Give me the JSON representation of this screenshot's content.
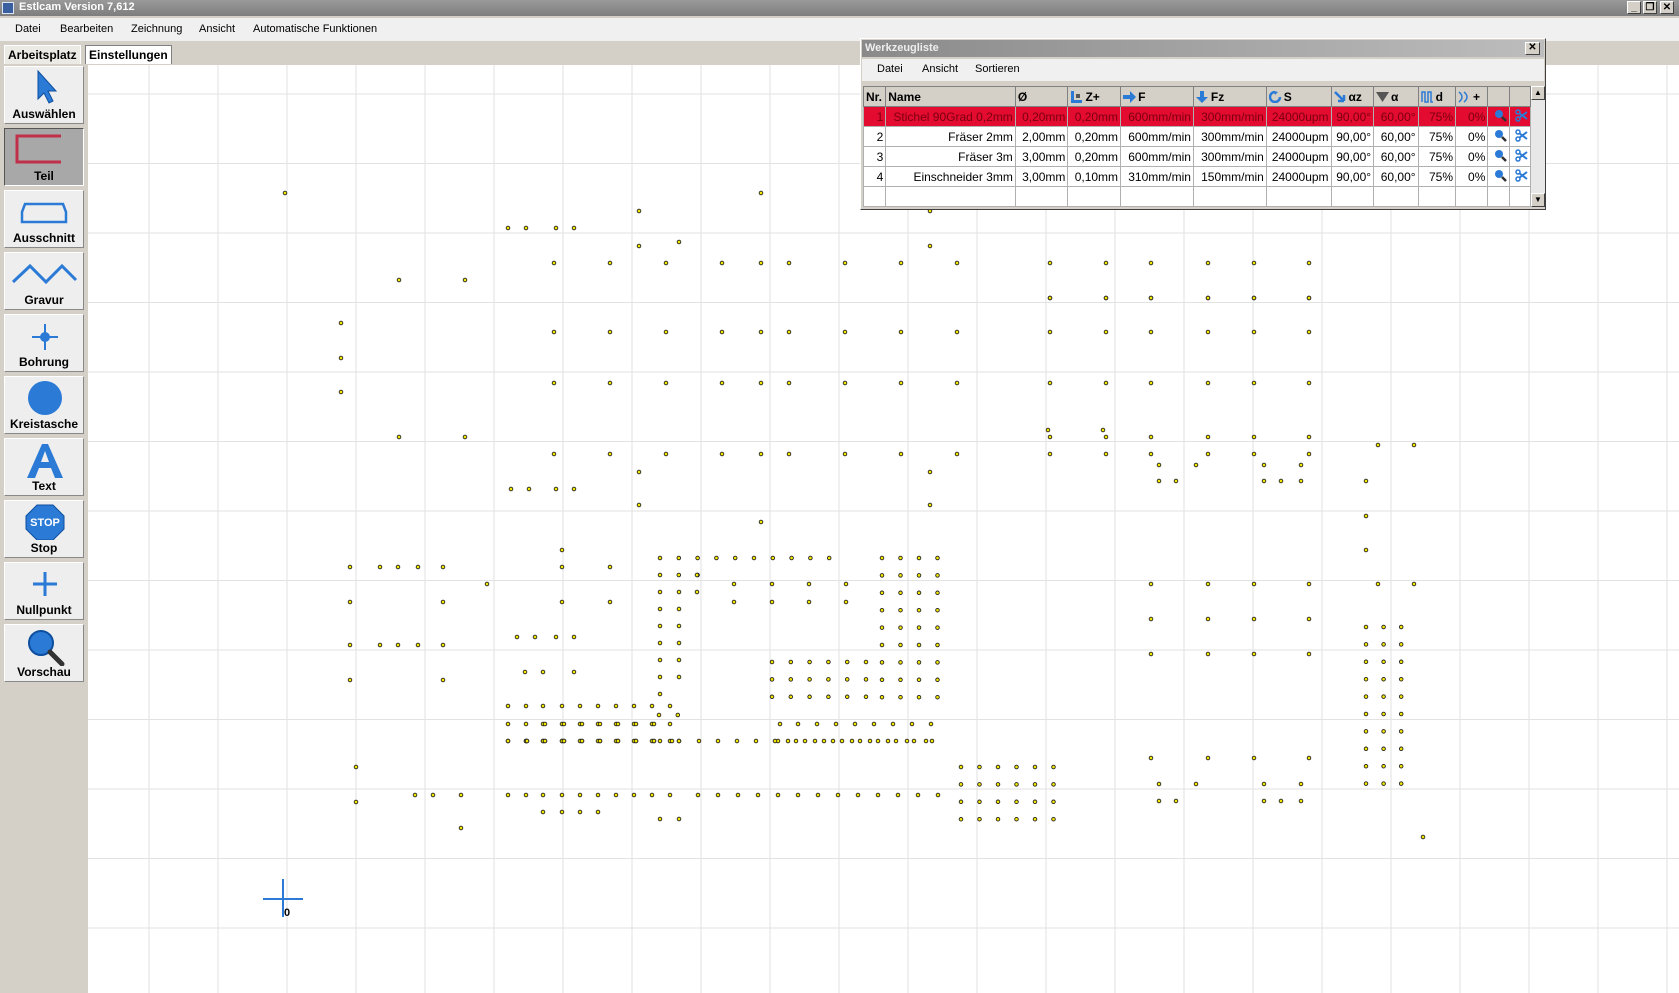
{
  "window": {
    "title": "Estlcam Version 7,612",
    "min": "_",
    "max": "❐",
    "close": "✕"
  },
  "menu": [
    "Datei",
    "Bearbeiten",
    "Zeichnung",
    "Ansicht",
    "Automatische Funktionen"
  ],
  "tabs": [
    "Arbeitsplatz",
    "Einstellungen"
  ],
  "tools": [
    {
      "label": "Auswählen",
      "icon": "cursor-arrow-icon"
    },
    {
      "label": "Teil",
      "icon": "part-outline-icon"
    },
    {
      "label": "Ausschnitt",
      "icon": "cutout-outline-icon"
    },
    {
      "label": "Gravur",
      "icon": "engrave-wave-icon"
    },
    {
      "label": "Bohrung",
      "icon": "drill-crosshair-icon"
    },
    {
      "label": "Kreistasche",
      "icon": "circle-pocket-icon"
    },
    {
      "label": "Text",
      "icon": "text-letter-icon"
    },
    {
      "label": "Stop",
      "icon": "stop-sign-icon",
      "sign_text": "STOP"
    },
    {
      "label": "Nullpunkt",
      "icon": "origin-plus-icon"
    },
    {
      "label": "Vorschau",
      "icon": "magnifier-icon"
    }
  ],
  "subtools": [
    "gear-icon",
    "tab-arrow-icon",
    "dots-icon",
    "scissors-icon"
  ],
  "colors": {
    "accent_blue": "#2a7ad6",
    "selection_red": "#e30b2f",
    "part_red": "#c0304a",
    "dot_yellow": "#f5e800"
  },
  "canvas": {
    "origin_label": "0"
  },
  "tool_list": {
    "title": "Werkzeugliste",
    "menu": [
      "Datei",
      "Ansicht",
      "Sortieren"
    ],
    "headers": [
      "Nr.",
      "Name",
      "Ø",
      "Z+",
      "F",
      "Fz",
      "S",
      "αz",
      "α",
      "d",
      "+"
    ],
    "rows": [
      {
        "nr": "1",
        "name": "Stichel 90Grad 0,2mm",
        "dia": "0,20mm",
        "zplus": "0,20mm",
        "f": "600mm/min",
        "fz": "300mm/min",
        "s": "24000upm",
        "az": "90,00°",
        "a": "60,00°",
        "d": "75%",
        "plus": "0%"
      },
      {
        "nr": "2",
        "name": "Fräser 2mm",
        "dia": "2,00mm",
        "zplus": "0,20mm",
        "f": "600mm/min",
        "fz": "300mm/min",
        "s": "24000upm",
        "az": "90,00°",
        "a": "60,00°",
        "d": "75%",
        "plus": "0%"
      },
      {
        "nr": "3",
        "name": "Fräser 3m",
        "dia": "3,00mm",
        "zplus": "0,20mm",
        "f": "600mm/min",
        "fz": "300mm/min",
        "s": "24000upm",
        "az": "90,00°",
        "a": "60,00°",
        "d": "75%",
        "plus": "0%"
      },
      {
        "nr": "4",
        "name": "Einschneider 3mm",
        "dia": "3,00mm",
        "zplus": "0,10mm",
        "f": "310mm/min",
        "fz": "150mm/min",
        "s": "24000upm",
        "az": "90,00°",
        "a": "60,00°",
        "d": "75%",
        "plus": "0%"
      }
    ]
  }
}
